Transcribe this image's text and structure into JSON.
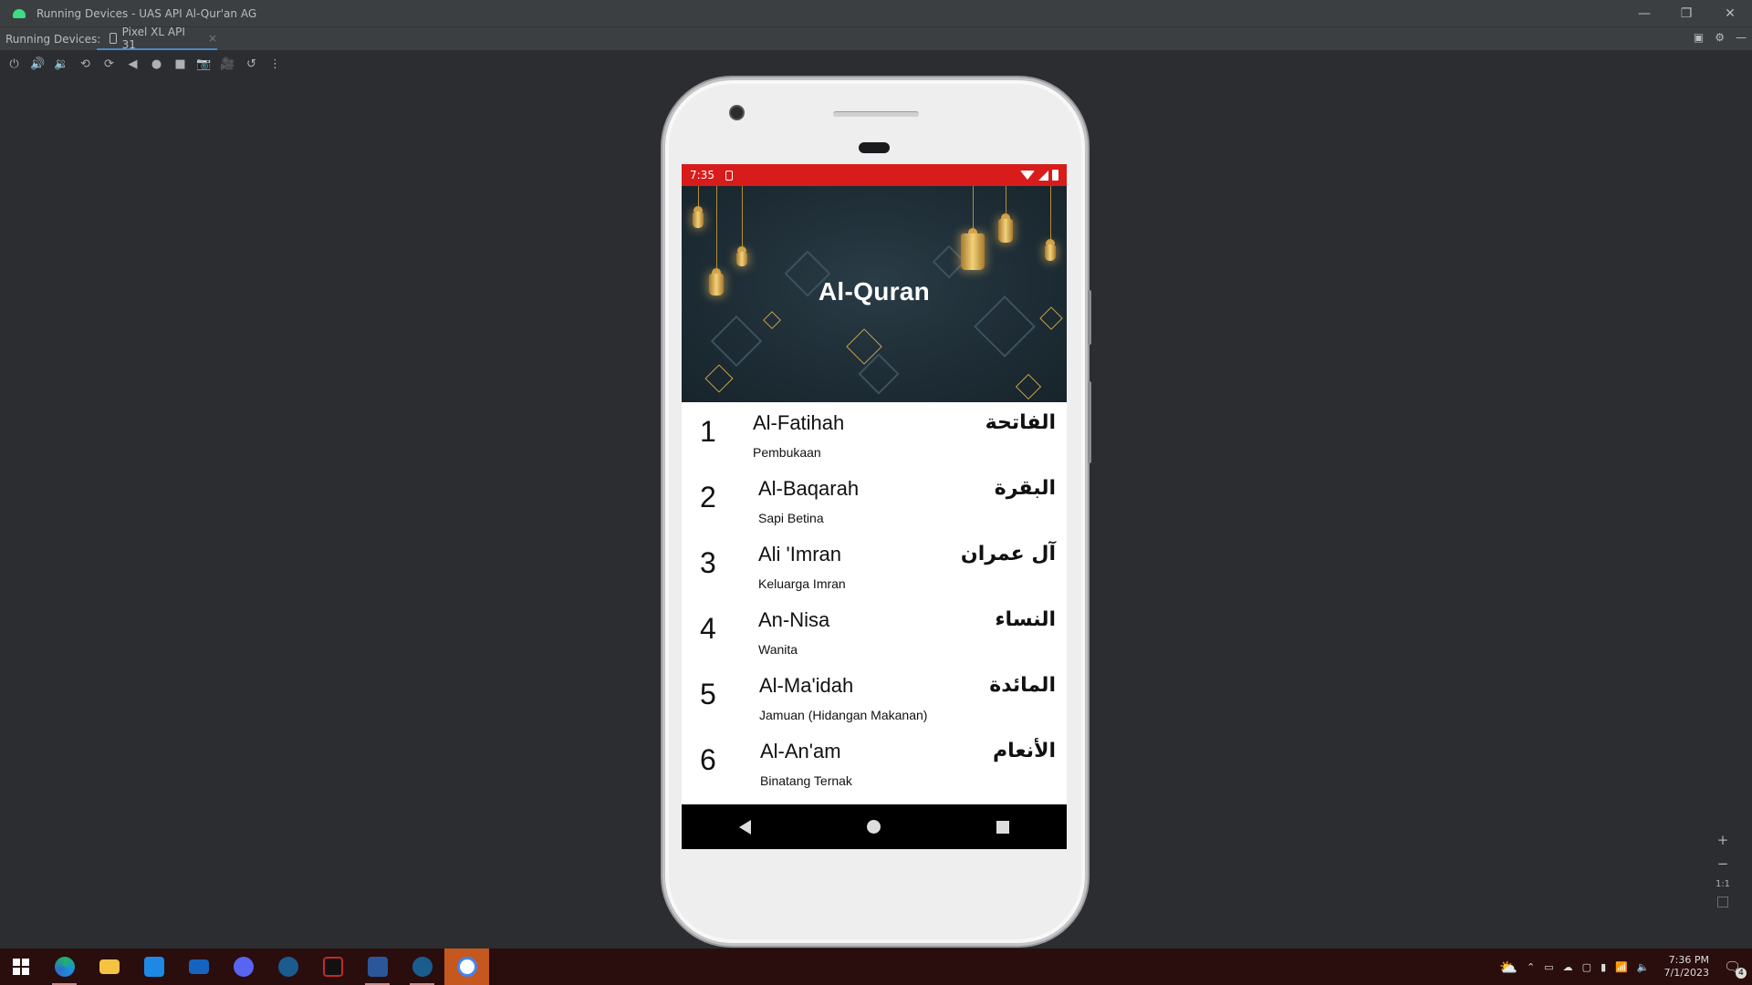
{
  "window": {
    "title": "Running Devices - UAS API Al-Qur'an AG",
    "minimize": "—",
    "restore": "❐",
    "close": "✕"
  },
  "tabs": {
    "label": "Running Devices:",
    "device_tab": "Pixel XL API 31",
    "close": "×"
  },
  "toolbar": {
    "icons": [
      "power-icon",
      "volume-up-icon",
      "volume-down-icon",
      "rotate-left-icon",
      "rotate-right-icon",
      "back-icon",
      "home-icon",
      "overview-icon",
      "screenshot-icon",
      "screen-record-icon",
      "reset-icon",
      "more-icon"
    ]
  },
  "zoom": {
    "plus": "+",
    "minus": "−",
    "one_to_one": "1:1"
  },
  "phone": {
    "status": {
      "time": "7:35"
    },
    "app": {
      "title": "Al-Quran",
      "surahs": [
        {
          "number": "1",
          "name": "Al-Fatihah",
          "arabic": "الفاتحة",
          "meaning": "Pembukaan"
        },
        {
          "number": "2",
          "name": "Al-Baqarah",
          "arabic": "البقرة",
          "meaning": "Sapi Betina"
        },
        {
          "number": "3",
          "name": "Ali 'Imran",
          "arabic": "آل عمران",
          "meaning": "Keluarga Imran"
        },
        {
          "number": "4",
          "name": "An-Nisa",
          "arabic": "النساء",
          "meaning": "Wanita"
        },
        {
          "number": "5",
          "name": "Al-Ma'idah",
          "arabic": "المائدة",
          "meaning": "Jamuan (Hidangan Makanan)"
        },
        {
          "number": "6",
          "name": "Al-An'am",
          "arabic": "الأنعام",
          "meaning": "Binatang Ternak"
        }
      ]
    }
  },
  "taskbar": {
    "clock_time": "7:36 PM",
    "clock_date": "7/1/2023",
    "notifications": "4",
    "apps": [
      "start-icon",
      "edge-icon",
      "file-explorer-icon",
      "store-icon",
      "mail-icon",
      "discord-icon",
      "steam-icon",
      "app-icon",
      "word-icon",
      "steam-icon",
      "android-studio-icon"
    ]
  },
  "colors": {
    "status_bar": "#d81b1b",
    "ide_bg": "#2b2d30",
    "taskbar": "#2a0d0d",
    "active_app": "#c4581e",
    "tab_underline": "#4a88c7"
  }
}
